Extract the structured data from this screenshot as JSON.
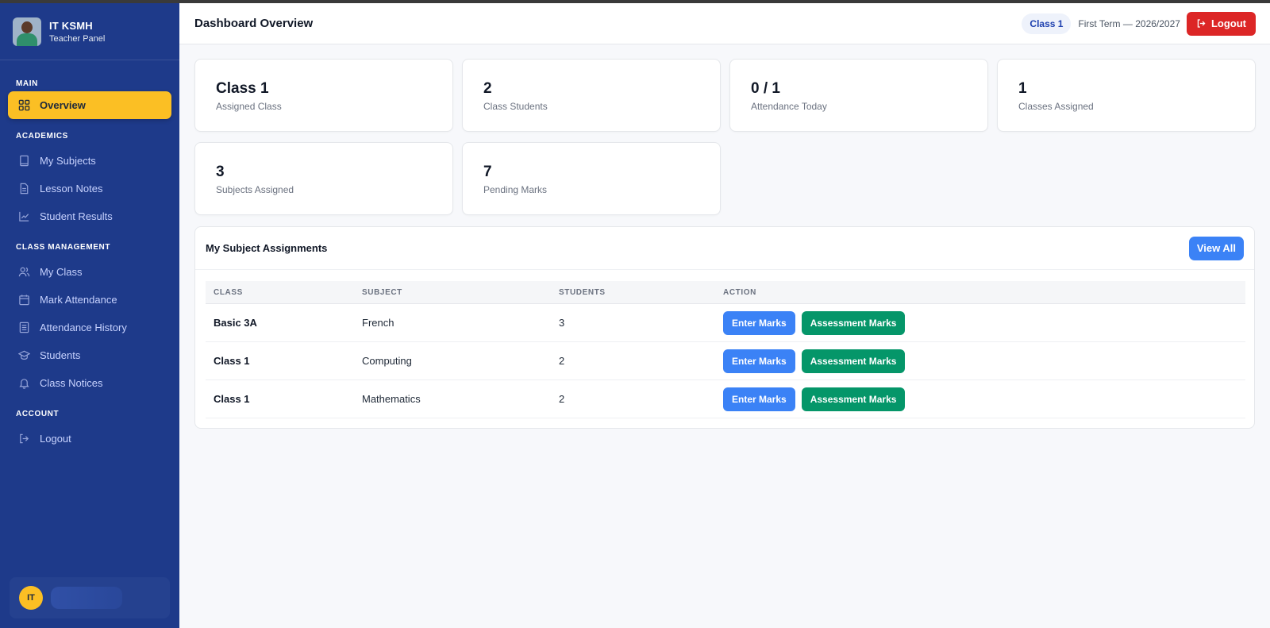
{
  "brand": {
    "title": "IT KSMH",
    "subtitle": "Teacher Panel"
  },
  "sidebar": {
    "sections": [
      {
        "label": "MAIN",
        "items": [
          {
            "label": "Overview",
            "icon": "grid-icon",
            "active": true
          }
        ]
      },
      {
        "label": "ACADEMICS",
        "items": [
          {
            "label": "My Subjects",
            "icon": "book-icon"
          },
          {
            "label": "Lesson Notes",
            "icon": "document-icon"
          },
          {
            "label": "Student Results",
            "icon": "chart-line-icon"
          }
        ]
      },
      {
        "label": "CLASS MANAGEMENT",
        "items": [
          {
            "label": "My Class",
            "icon": "users-icon"
          },
          {
            "label": "Mark Attendance",
            "icon": "calendar-icon"
          },
          {
            "label": "Attendance History",
            "icon": "list-icon"
          },
          {
            "label": "Students",
            "icon": "graduation-cap-icon"
          },
          {
            "label": "Class Notices",
            "icon": "bell-icon"
          }
        ]
      },
      {
        "label": "ACCOUNT",
        "items": [
          {
            "label": "Logout",
            "icon": "logout-icon"
          }
        ]
      }
    ],
    "user": {
      "initials": "IT"
    }
  },
  "header": {
    "title": "Dashboard Overview",
    "class_badge": "Class 1",
    "term": "First Term — 2026/2027",
    "logout_label": "Logout"
  },
  "stats": [
    {
      "value": "Class 1",
      "label": "Assigned Class"
    },
    {
      "value": "2",
      "label": "Class Students"
    },
    {
      "value": "0 / 1",
      "label": "Attendance Today"
    },
    {
      "value": "1",
      "label": "Classes Assigned"
    },
    {
      "value": "3",
      "label": "Subjects Assigned"
    },
    {
      "value": "7",
      "label": "Pending Marks"
    }
  ],
  "assignments": {
    "title": "My Subject Assignments",
    "view_all_label": "View All",
    "columns": [
      "CLASS",
      "SUBJECT",
      "STUDENTS",
      "ACTION"
    ],
    "rows": [
      {
        "class": "Basic 3A",
        "subject": "French",
        "students": "3",
        "action1": "Enter Marks",
        "action2": "Assessment Marks"
      },
      {
        "class": "Class 1",
        "subject": "Computing",
        "students": "2",
        "action1": "Enter Marks",
        "action2": "Assessment Marks"
      },
      {
        "class": "Class 1",
        "subject": "Mathematics",
        "students": "2",
        "action1": "Enter Marks",
        "action2": "Assessment Marks"
      }
    ]
  },
  "colors": {
    "sidebar": "#1e3a8a",
    "active": "#fbbf24",
    "primary": "#3b82f6",
    "success": "#059669",
    "danger": "#dc2626"
  }
}
